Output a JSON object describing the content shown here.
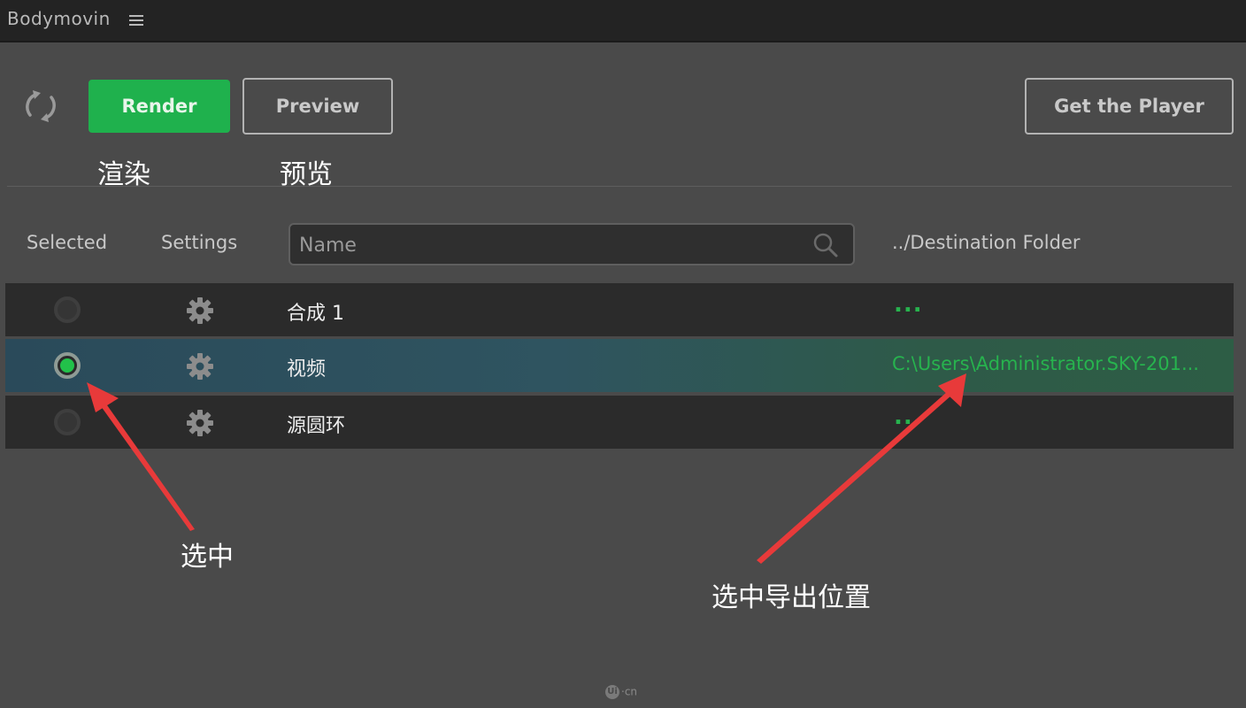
{
  "titlebar": {
    "title": "Bodymovin",
    "menu_icon": "hamburger-menu-icon"
  },
  "toolbar": {
    "refresh_icon": "refresh-icon",
    "render_label": "Render",
    "preview_label": "Preview",
    "player_label": "Get the Player",
    "render_color": "#1fb14d"
  },
  "annotations": {
    "render": "渲染",
    "preview": "预览",
    "select": "选中",
    "export_location": "选中导出位置",
    "arrow_color": "#e83a3a"
  },
  "table": {
    "headers": {
      "selected": "Selected",
      "settings": "Settings",
      "destination": "../Destination Folder"
    },
    "search": {
      "placeholder": "Name",
      "value": ""
    },
    "rows": [
      {
        "name": "合成 1",
        "selected": false,
        "destination": "...",
        "destination_is_path": false
      },
      {
        "name": "视频",
        "selected": true,
        "destination": "C:\\Users\\Administrator.SKY-201...",
        "destination_is_path": true
      },
      {
        "name": "源圆环",
        "selected": false,
        "destination": "...",
        "destination_is_path": false
      }
    ],
    "accent_color": "#27b34e"
  },
  "watermark": {
    "mark": "Ui",
    "text": "·cn"
  }
}
